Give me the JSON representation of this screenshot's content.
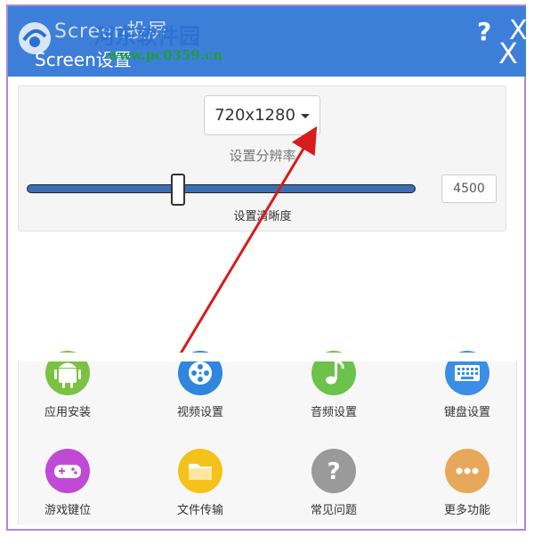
{
  "titlebar": {
    "back_text": "Screen投屏",
    "title": "Screen设置",
    "help_label": "?",
    "close_back_label": "X",
    "close_label": "X",
    "accent_color": "#3d7fd8"
  },
  "watermark": {
    "main": "河东软件园",
    "sub": "www.pc0359.cn"
  },
  "settings": {
    "resolution_value": "720x1280",
    "resolution_label": "设置分辨率",
    "clarity_label": "设置清晰度",
    "clarity_fraction": 0.39,
    "bitrate_value": "4500"
  },
  "features": [
    {
      "label": "应用安装",
      "icon": "android-icon",
      "color": "#7cc242"
    },
    {
      "label": "视频设置",
      "icon": "film-reel-icon",
      "color": "#2e86de"
    },
    {
      "label": "音频设置",
      "icon": "music-note-icon",
      "color": "#6cc24a"
    },
    {
      "label": "键盘设置",
      "icon": "keyboard-icon",
      "color": "#3a8ee6"
    },
    {
      "label": "游戏键位",
      "icon": "gamepad-icon",
      "color": "#c04ad6"
    },
    {
      "label": "文件传输",
      "icon": "folder-icon",
      "color": "#f5c21b"
    },
    {
      "label": "常见问题",
      "icon": "question-icon",
      "color": "#9a9a9a"
    },
    {
      "label": "更多功能",
      "icon": "more-dots-icon",
      "color": "#e8a85c"
    }
  ]
}
